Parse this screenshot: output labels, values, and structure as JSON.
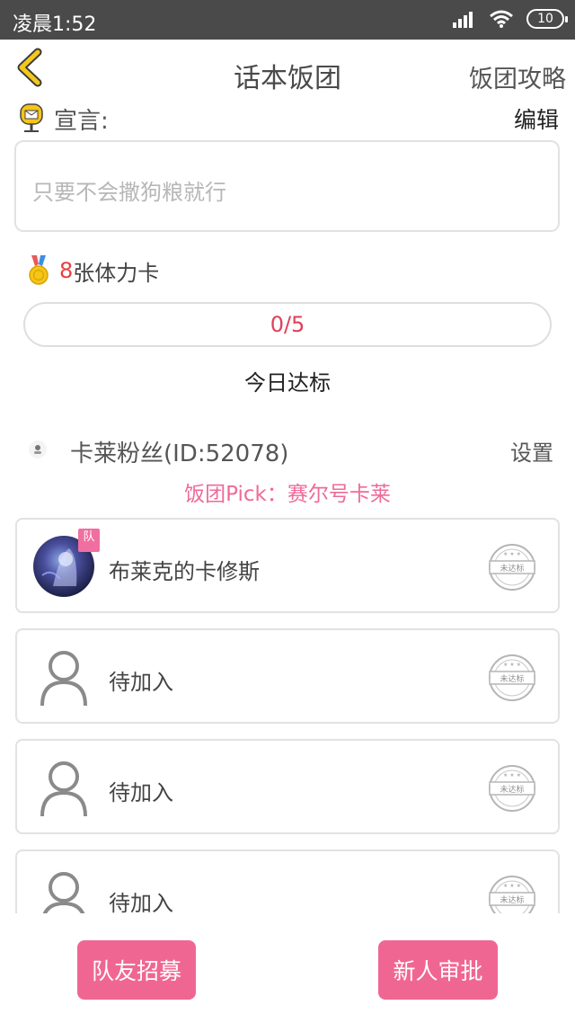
{
  "status_bar": {
    "time": "凌晨1:52",
    "battery": "10"
  },
  "nav": {
    "title": "话本饭团",
    "right_link": "饭团攻略"
  },
  "declaration": {
    "label": "宣言:",
    "edit_label": "编辑",
    "placeholder": "只要不会撒狗粮就行"
  },
  "stamina": {
    "count": "8",
    "text": "张体力卡"
  },
  "progress": {
    "text": "0/5",
    "fraction": 0
  },
  "today_label": "今日达标",
  "group": {
    "name": "卡莱粉丝(ID:52078)",
    "settings_label": "设置",
    "pick": "饭团Pick：赛尔号卡莱"
  },
  "members": [
    {
      "name": "布莱克的卡修斯",
      "leader_badge": "队",
      "status": "未达标",
      "has_avatar": true
    },
    {
      "name": "待加入",
      "status": "未达标",
      "has_avatar": false
    },
    {
      "name": "待加入",
      "status": "未达标",
      "has_avatar": false
    },
    {
      "name": "待加入",
      "status": "未达标",
      "has_avatar": false
    }
  ],
  "buttons": {
    "recruit": "队友招募",
    "approve": "新人审批"
  },
  "colors": {
    "accent_pink": "#f06693",
    "pick_pink": "#ef6a9a",
    "count_red": "#e83e3e",
    "back_yellow": "#f2c81e"
  }
}
